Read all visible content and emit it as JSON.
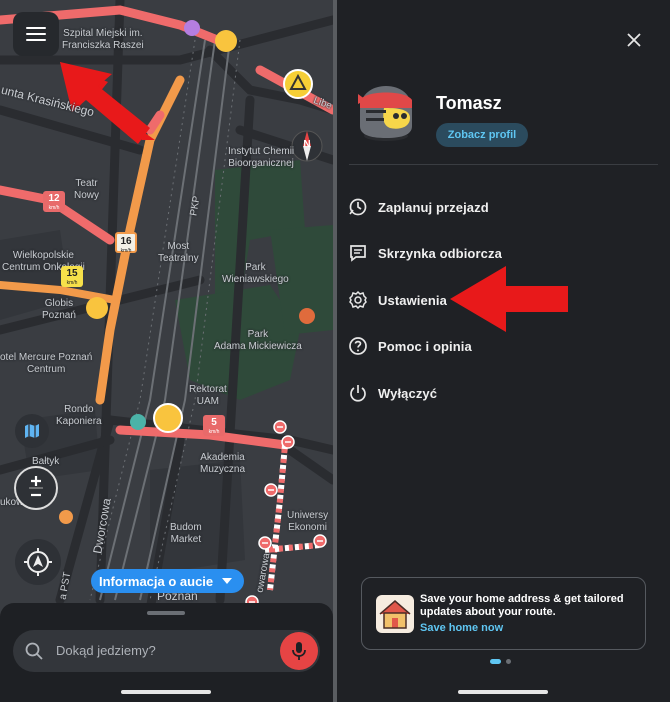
{
  "map": {
    "labels": {
      "szpital": "Szpital Miejski im.\nFranciszka Raszei",
      "street_krasinskiego": "unta Krasińskiego",
      "teatr_nowy": "Teatr\nNowy",
      "instytut": "Instytut Chemii\nBioorganicznej",
      "wielkopolskie": "Wielkopolskie\nCentrum Onkologii",
      "pkp": "PKP",
      "most": "Most\nTeatralny",
      "park_wieniawskiego": "Park\nWieniawskiego",
      "globis": "Globis\nPoznań",
      "park_mickiewicza": "Park\nAdama Mickiewicza",
      "hotel": "otel Mercure Poznań\nCentrum",
      "rektorat": "Rektorat\nUAM",
      "rondo": "Rondo\nKaponiera",
      "akademia": "Akademia\nMuzyczna",
      "baltyk": "Bałtyk",
      "zukowska": "ukowska",
      "budom": "Budom\nMarket",
      "dworcowa": "Dworcowa",
      "uniwersytet": "Uniwersy\nEkonomi",
      "glowna": "owarowa",
      "poznan": "Poznań",
      "liberum": "Libe",
      "wesola": "a PST"
    },
    "speed_badges": [
      {
        "value": "12",
        "unit": "km/h"
      },
      {
        "value": "16",
        "unit": "km/h"
      },
      {
        "value": "15",
        "unit": "km/h"
      },
      {
        "value": "5",
        "unit": "km/h"
      }
    ],
    "compass_letter": "N",
    "car_info_label": "Informacja o aucie",
    "search_placeholder": "Dokąd jedziemy?"
  },
  "menu": {
    "user_name": "Tomasz",
    "profile_button": "Zobacz profil",
    "items": [
      {
        "label": "Zaplanuj przejazd",
        "icon": "clock-plan-icon"
      },
      {
        "label": "Skrzynka odbiorcza",
        "icon": "inbox-icon"
      },
      {
        "label": "Ustawienia",
        "icon": "gear-icon"
      },
      {
        "label": "Pomoc i opinia",
        "icon": "help-icon"
      },
      {
        "label": "Wyłączyć",
        "icon": "power-icon"
      }
    ],
    "home_card": {
      "title": "Save your home address & get tailored updates about your route.",
      "link": "Save home now"
    }
  },
  "colors": {
    "accent_blue": "#2a8ff0",
    "link_cyan": "#5fc6f2",
    "annotation_red": "#e8191a",
    "traffic_red": "#ef6b6b",
    "traffic_orange": "#f29a4a"
  }
}
